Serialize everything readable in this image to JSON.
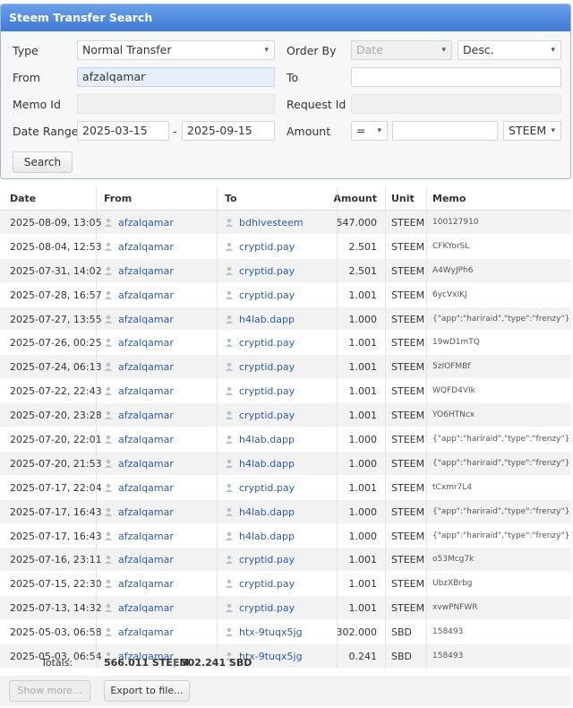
{
  "panel": {
    "title": "Steem Transfer Search",
    "type_label": "Type",
    "type_value": "Normal Transfer",
    "order_label": "Order By",
    "order_value": "Date",
    "order_dir": "Desc.",
    "from_label": "From",
    "from_value": "afzalqamar",
    "to_label": "To",
    "to_value": "",
    "memo_label": "Memo Id",
    "request_label": "Request Id",
    "date_label": "Date Range",
    "date_from": "2025-03-15",
    "date_sep": "-",
    "date_to": "2025-09-15",
    "amount_label": "Amount",
    "amount_op": "=",
    "amount_value": "",
    "amount_unit": "STEEM",
    "search_label": "Search"
  },
  "table": {
    "headers": {
      "date": "Date",
      "from": "From",
      "to": "To",
      "amount": "Amount",
      "unit": "Unit",
      "memo": "Memo"
    },
    "rows": [
      {
        "date": "2025-08-09, 13:05",
        "from": "afzalqamar",
        "to": "bdhivesteem",
        "amount": "547.000",
        "unit": "STEEM",
        "memo": "100127910"
      },
      {
        "date": "2025-08-04, 12:53",
        "from": "afzalqamar",
        "to": "cryptid.pay",
        "amount": "2.501",
        "unit": "STEEM",
        "memo": "CFKYorSL"
      },
      {
        "date": "2025-07-31, 14:02",
        "from": "afzalqamar",
        "to": "cryptid.pay",
        "amount": "2.501",
        "unit": "STEEM",
        "memo": "A4WyJPh6"
      },
      {
        "date": "2025-07-28, 16:57",
        "from": "afzalqamar",
        "to": "cryptid.pay",
        "amount": "1.001",
        "unit": "STEEM",
        "memo": "6ycVxIKJ"
      },
      {
        "date": "2025-07-27, 13:55",
        "from": "afzalqamar",
        "to": "h4lab.dapp",
        "amount": "1.000",
        "unit": "STEEM",
        "memo": "{\"app\":\"hariraid\",\"type\":\"frenzy\"}"
      },
      {
        "date": "2025-07-26, 00:25",
        "from": "afzalqamar",
        "to": "cryptid.pay",
        "amount": "1.001",
        "unit": "STEEM",
        "memo": "19wD1mTQ"
      },
      {
        "date": "2025-07-24, 06:13",
        "from": "afzalqamar",
        "to": "cryptid.pay",
        "amount": "1.001",
        "unit": "STEEM",
        "memo": "5zIOFMBf"
      },
      {
        "date": "2025-07-22, 22:43",
        "from": "afzalqamar",
        "to": "cryptid.pay",
        "amount": "1.001",
        "unit": "STEEM",
        "memo": "WQFD4VIk"
      },
      {
        "date": "2025-07-20, 23:28",
        "from": "afzalqamar",
        "to": "cryptid.pay",
        "amount": "1.001",
        "unit": "STEEM",
        "memo": "YO6HTNcx"
      },
      {
        "date": "2025-07-20, 22:01",
        "from": "afzalqamar",
        "to": "h4lab.dapp",
        "amount": "1.000",
        "unit": "STEEM",
        "memo": "{\"app\":\"hariraid\",\"type\":\"frenzy\"}"
      },
      {
        "date": "2025-07-20, 21:53",
        "from": "afzalqamar",
        "to": "h4lab.dapp",
        "amount": "1.000",
        "unit": "STEEM",
        "memo": "{\"app\":\"hariraid\",\"type\":\"frenzy\"}"
      },
      {
        "date": "2025-07-17, 22:04",
        "from": "afzalqamar",
        "to": "cryptid.pay",
        "amount": "1.001",
        "unit": "STEEM",
        "memo": "tCxmr7L4"
      },
      {
        "date": "2025-07-17, 16:43",
        "from": "afzalqamar",
        "to": "h4lab.dapp",
        "amount": "1.000",
        "unit": "STEEM",
        "memo": "{\"app\":\"hariraid\",\"type\":\"frenzy\"}"
      },
      {
        "date": "2025-07-17, 16:43",
        "from": "afzalqamar",
        "to": "h4lab.dapp",
        "amount": "1.000",
        "unit": "STEEM",
        "memo": "{\"app\":\"hariraid\",\"type\":\"frenzy\"}"
      },
      {
        "date": "2025-07-16, 23:11",
        "from": "afzalqamar",
        "to": "cryptid.pay",
        "amount": "1.001",
        "unit": "STEEM",
        "memo": "o53Mcg7k"
      },
      {
        "date": "2025-07-15, 22:30",
        "from": "afzalqamar",
        "to": "cryptid.pay",
        "amount": "1.001",
        "unit": "STEEM",
        "memo": "UbzXBrbg"
      },
      {
        "date": "2025-07-13, 14:32",
        "from": "afzalqamar",
        "to": "cryptid.pay",
        "amount": "1.001",
        "unit": "STEEM",
        "memo": "xvwPNFWR"
      },
      {
        "date": "2025-05-03, 06:58",
        "from": "afzalqamar",
        "to": "htx-9tuqx5jg",
        "amount": "302.000",
        "unit": "SBD",
        "memo": "158493"
      },
      {
        "date": "2025-05-03, 06:54",
        "from": "afzalqamar",
        "to": "htx-9tuqx5jg",
        "amount": "0.241",
        "unit": "SBD",
        "memo": "158493"
      }
    ]
  },
  "totals": {
    "label": "Totals:",
    "steem": "566.011 STEEM",
    "sep": "|",
    "sbd": "302.241 SBD"
  },
  "footer": {
    "show_more": "Show more...",
    "export": "Export to file..."
  },
  "colors": {
    "header": "#3f7ad6",
    "link": "#2a5db0",
    "stripe": "#f2f2f2"
  },
  "icons": {
    "user": "user-icon"
  }
}
